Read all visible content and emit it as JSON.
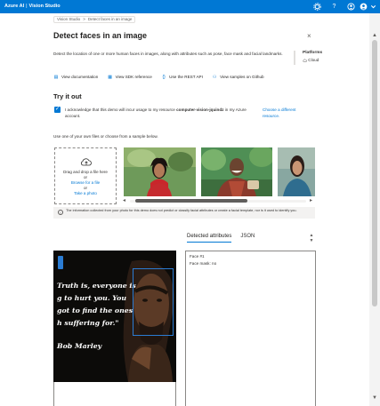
{
  "topbar": {
    "brand": "Azure AI",
    "separator": "|",
    "product": "Vision Studio",
    "icons": [
      "settings-icon",
      "help-icon",
      "account-icon",
      "avatar-icon",
      "chevron-down-icon"
    ]
  },
  "breadcrumb": {
    "items": [
      "Vision Studio",
      "Detect faces in an image"
    ],
    "separator": ">"
  },
  "page": {
    "title": "Detect faces in an image",
    "close_glyph": "×",
    "description": "Detect the location of one or more human faces in images, along with attributes such as pose, face mask and facial landmarks."
  },
  "platform": {
    "title": "Platforms",
    "value": "Cloud"
  },
  "links": [
    {
      "icon": "document-icon",
      "label": "View documentation"
    },
    {
      "icon": "sdk-icon",
      "label": "View SDK reference"
    },
    {
      "icon": "code-icon",
      "label": "Use the REST API"
    },
    {
      "icon": "github-icon",
      "label": "View samples on Github"
    }
  ],
  "try_it": {
    "heading": "Try it out",
    "ack_prefix": "I acknowledge that this demo will incur usage to my resource ",
    "ack_resource": "computer-vision-jquindz",
    "ack_suffix": " in my Azure account.",
    "choose_resource": "Choose a different resource.",
    "use_one": "Use one of your own files or choose from a sample below."
  },
  "dropzone": {
    "line1": "Drag and drop a file here",
    "line2": "or",
    "line3": "Browse for a file",
    "line4": "or",
    "line5": "Take a photo"
  },
  "notice": "The information collected from your photo for this demo does not predict or classify facial attributes or create a facial template, nor is it used to identify you.",
  "result": {
    "tabs": [
      "Detected attributes",
      "JSON"
    ],
    "active_tab": 0,
    "quote_lines": [
      "Truth is, everyone is",
      "g to hurt you. You",
      "got to find the ones",
      "h suffering for.\"",
      "Bob Marley"
    ],
    "attributes": [
      "Face #1",
      "Face mask: no"
    ]
  },
  "colors": {
    "accent": "#0078d4",
    "face_box": "#2b7cd3"
  }
}
